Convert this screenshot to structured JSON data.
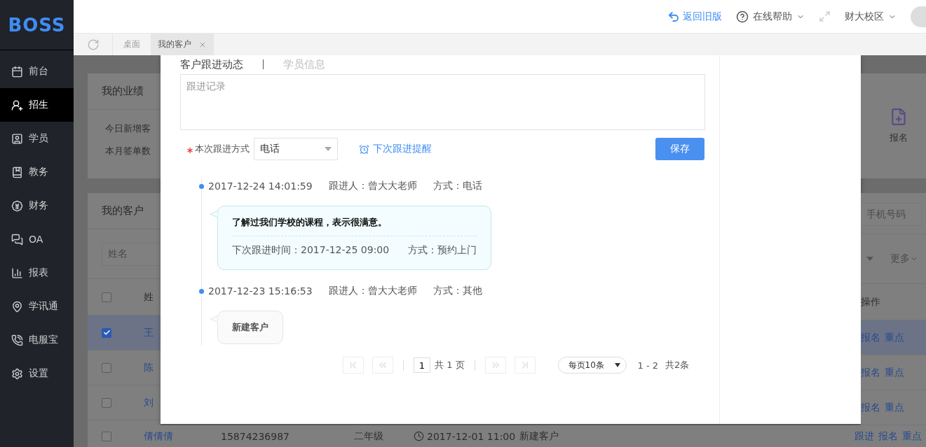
{
  "sidebar": {
    "logo": "BOSS",
    "items": [
      {
        "label": "前台",
        "selected": false
      },
      {
        "label": "招生",
        "selected": true
      },
      {
        "label": "学员",
        "selected": false
      },
      {
        "label": "教务",
        "selected": false
      },
      {
        "label": "财务",
        "selected": false
      },
      {
        "label": "OA",
        "selected": false
      },
      {
        "label": "报表",
        "selected": false
      },
      {
        "label": "学讯通",
        "selected": false
      },
      {
        "label": "电服宝",
        "selected": false
      },
      {
        "label": "设置",
        "selected": false
      }
    ]
  },
  "topbar": {
    "back_link": "返回旧版",
    "help": "在线帮助",
    "campus": "财大校区"
  },
  "tabs": [
    {
      "label": "桌面",
      "selected": false,
      "closable": false
    },
    {
      "label": "我的客户",
      "selected": true,
      "closable": true
    }
  ],
  "background": {
    "left": {
      "performance_title": "我的业绩",
      "stats": [
        "今日新增客",
        "本月签单数"
      ],
      "customers_title": "我的客户",
      "name_placeholder": "姓名",
      "header_checked": false,
      "column_1": "姓",
      "rows": [
        {
          "name": "王",
          "checked": true
        },
        {
          "name": "陈",
          "checked": false
        },
        {
          "name": "刘",
          "checked": false
        }
      ]
    },
    "right": {
      "enroll_label": "报名",
      "phone_placeholder": "手机号码",
      "more": "更多",
      "column_ops": "操作",
      "rows": [
        [
          "报名",
          "重点"
        ],
        [
          "报名",
          "重点"
        ],
        [
          "报名",
          "重点"
        ]
      ]
    },
    "last_row": {
      "checked": false,
      "name": "倩倩倩",
      "phone": "15874236987",
      "grade": "二年级",
      "time": "2017-12-01 11:00",
      "status": "新建客户",
      "actions": [
        "跟进",
        "报名",
        "重点"
      ]
    }
  },
  "modal": {
    "tabs": [
      {
        "label": "客户跟进动态",
        "selected": true
      },
      {
        "label": "学员信息",
        "selected": false
      }
    ],
    "note_placeholder": "跟进记录",
    "method_required": true,
    "method_label": "本次跟进方式",
    "method_value": "电话",
    "reminder_link": "下次跟进提醒",
    "save": "保存",
    "timeline": [
      {
        "kind": "detail",
        "time": "2017-12-24 14:01:59",
        "follower": "跟进人：曾大大老师",
        "method": "方式：电话",
        "note": "了解过我们学校的课程，表示很满意。",
        "next_time": "下次跟进时间：2017-12-25 09:00",
        "next_method": "方式：预约上门"
      },
      {
        "kind": "simple",
        "time": "2017-12-23 15:16:53",
        "follower": "跟进人：曾大大老师",
        "method": "方式：其他",
        "note": "新建客户"
      }
    ],
    "pagination": {
      "page": "1",
      "total_pages": "共 1 页",
      "page_size": "每页10条",
      "range": "1 - 2",
      "total": "共2条"
    }
  }
}
